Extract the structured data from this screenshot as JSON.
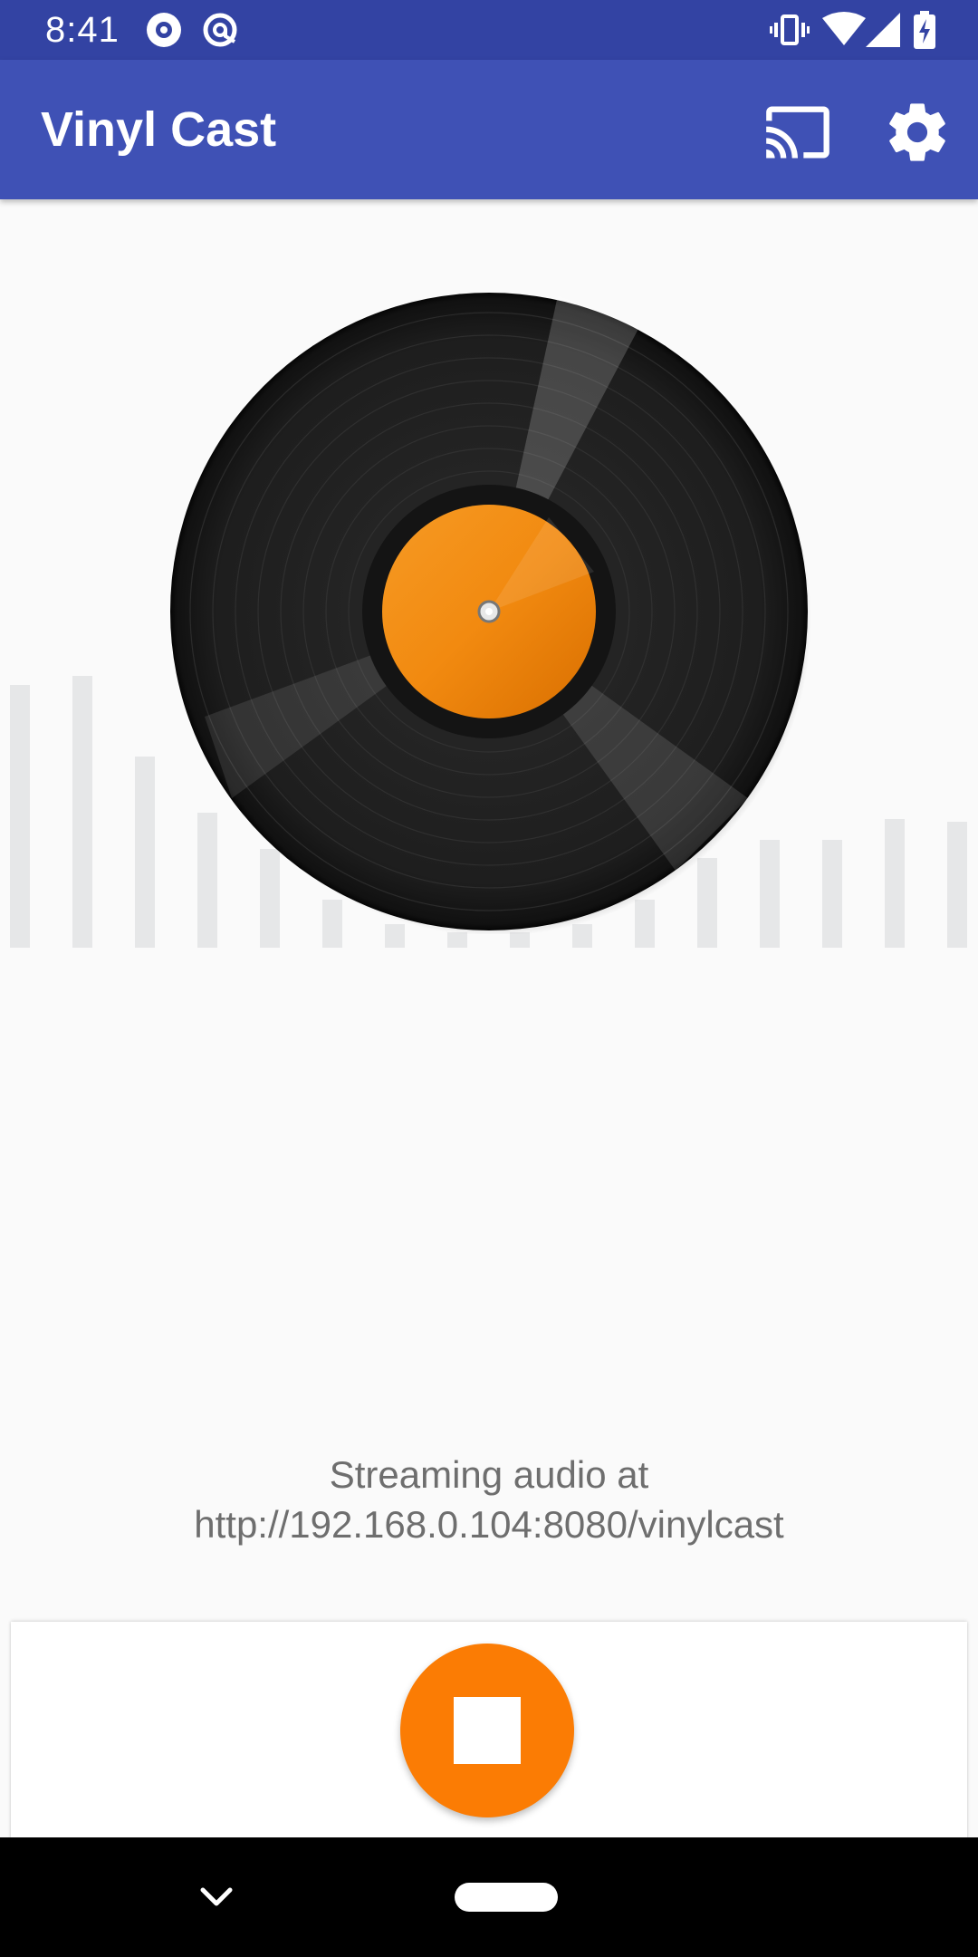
{
  "status_bar": {
    "time": "8:41",
    "left_icons": [
      "media-disc-icon",
      "at-sign-icon"
    ],
    "right_icons": [
      "vibrate-icon",
      "wifi-icon",
      "cell-signal-icon",
      "battery-charging-icon"
    ]
  },
  "app_bar": {
    "title": "Vinyl Cast",
    "actions": [
      "cast-icon",
      "gear-icon"
    ]
  },
  "main": {
    "visualizer_levels": [
      0.88,
      0.91,
      0.64,
      0.45,
      0.33,
      0.16,
      0.08,
      0.05,
      0.05,
      0.08,
      0.16,
      0.3,
      0.36,
      0.36,
      0.43,
      0.42
    ],
    "record_label_color": "#f28a10",
    "streaming_line1": "Streaming audio at",
    "streaming_line2": "http://192.168.0.104:8080/vinylcast"
  },
  "controls": {
    "primary_action_icon": "stop-icon",
    "accent_color": "#fb7c04"
  },
  "nav_bar": {
    "icons": [
      "chevron-down-icon",
      "home-pill-icon"
    ]
  }
}
